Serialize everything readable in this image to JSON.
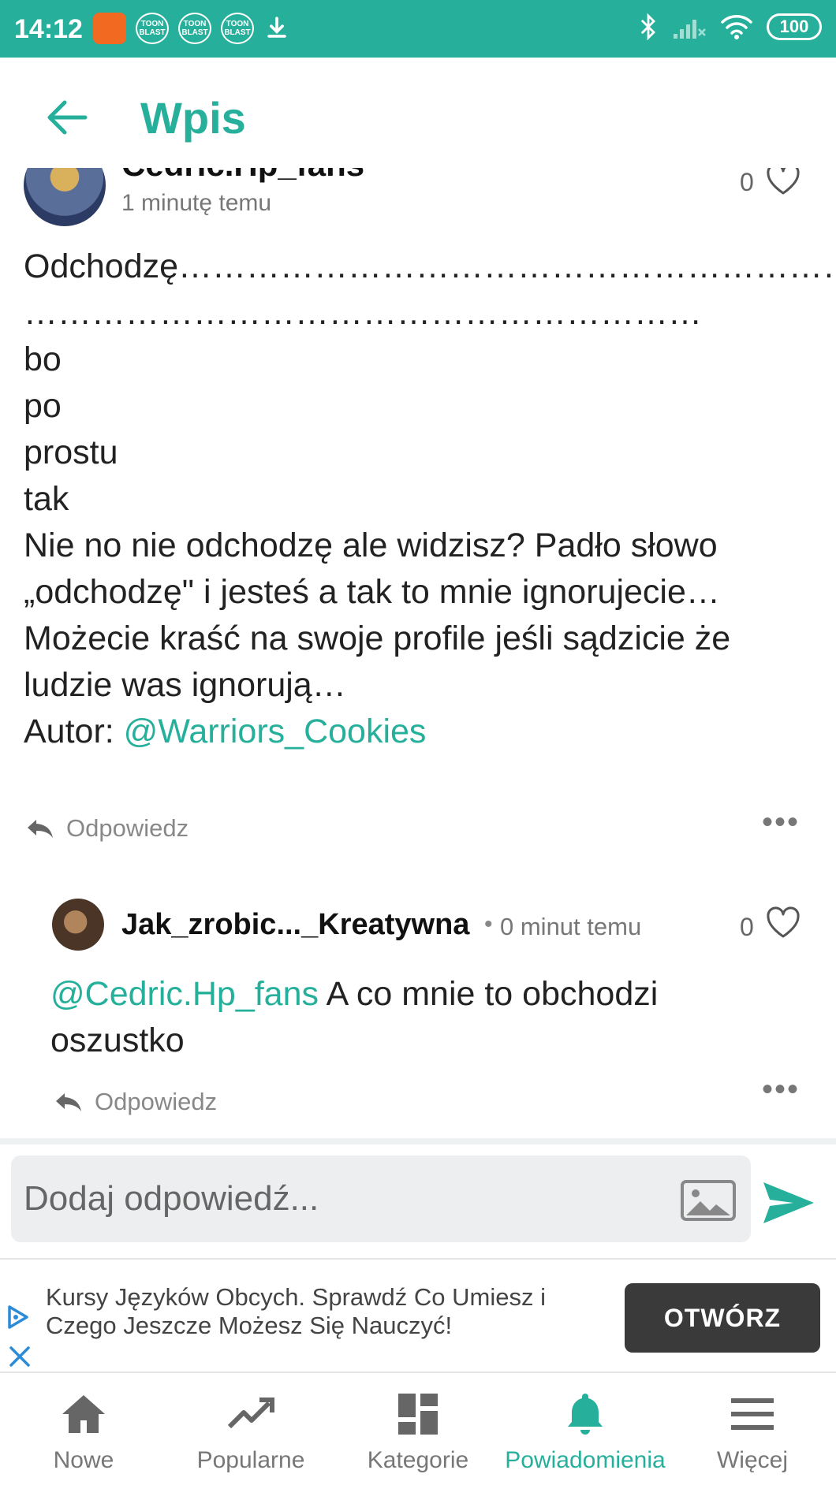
{
  "status_bar": {
    "time": "14:12",
    "app_badge": "",
    "toon_label": "TOON BLAST",
    "battery": "100"
  },
  "header": {
    "title": "Wpis"
  },
  "post": {
    "author": "Cedric.Hp_fans",
    "time": "1 minutę temu",
    "likes": "0",
    "body": "Odchodzę………………………………………………………………………\n……………………………………………………\nbo\npo\nprostu\ntak\nNie no nie odchodzę ale widzisz? Padło słowo „odchodzę\" i jesteś a tak to mnie ignorujecie…\nMożecie kraść na swoje profile jeśli sądzicie że ludzie was ignorują…\nAutor: ",
    "mention": "@Warriors_Cookies",
    "reply_label": "Odpowiedz",
    "more": "•••"
  },
  "comment": {
    "author": "Jak_zrobic..._Kreatywna",
    "separator": "•",
    "time": "0 minut temu",
    "likes": "0",
    "mention": "@Cedric.Hp_fans",
    "body": " A co mnie to obchodzi oszustko",
    "reply_label": "Odpowiedz",
    "more": "•••"
  },
  "composer": {
    "placeholder": "Dodaj odpowiedź..."
  },
  "ad": {
    "text": "Kursy Języków Obcych. Sprawdź Co Umiesz i Czego Jeszcze Możesz Się Nauczyć!",
    "cta": "OTWÓRZ"
  },
  "bottom_nav": {
    "items": [
      {
        "label": "Nowe",
        "icon": "home-icon"
      },
      {
        "label": "Popularne",
        "icon": "trending-icon"
      },
      {
        "label": "Kategorie",
        "icon": "grid-icon"
      },
      {
        "label": "Powiadomienia",
        "icon": "bell-icon",
        "active": true
      },
      {
        "label": "Więcej",
        "icon": "menu-icon"
      }
    ]
  },
  "colors": {
    "accent": "#26b09b",
    "status_bar": "#26b09b",
    "ad_button": "#3a3a3a"
  }
}
